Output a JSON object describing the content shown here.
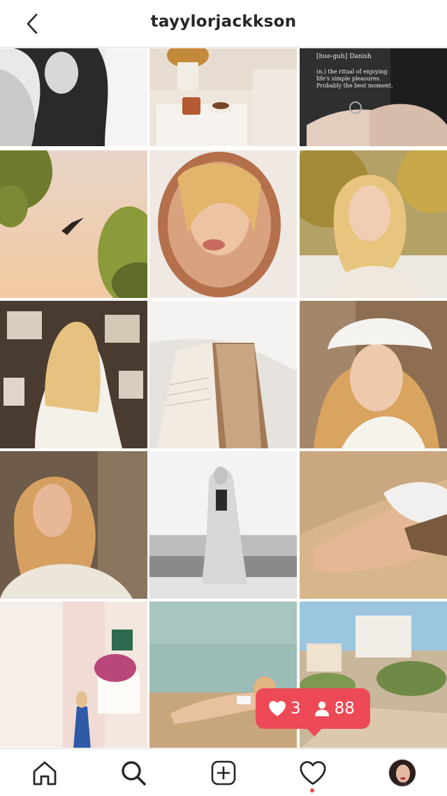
{
  "header": {
    "username": "tayylorjackkson"
  },
  "notification": {
    "likes": "3",
    "followers": "88",
    "color": "#ed4956"
  },
  "grid": {
    "posts": [
      "portrait-black-top",
      "flowers-coffee-nightstand",
      "hygge-text-hands",
      "bird-sky-trees",
      "face-in-gold-mirror",
      "blonde-autumn-trees",
      "gallery-wall-back",
      "open-book",
      "white-fur-hat",
      "lace-cover-up-rock",
      "beach-white-outfit",
      "bikini-sand",
      "pastel-houses-street",
      "lying-on-sand",
      "seaside-town"
    ]
  },
  "bottom_nav": {
    "items": [
      "home",
      "search",
      "new-post",
      "activity",
      "profile"
    ],
    "active": "search"
  },
  "colors": {
    "accent": "#ed4956",
    "text": "#262626",
    "divider": "#dbdbdb"
  }
}
